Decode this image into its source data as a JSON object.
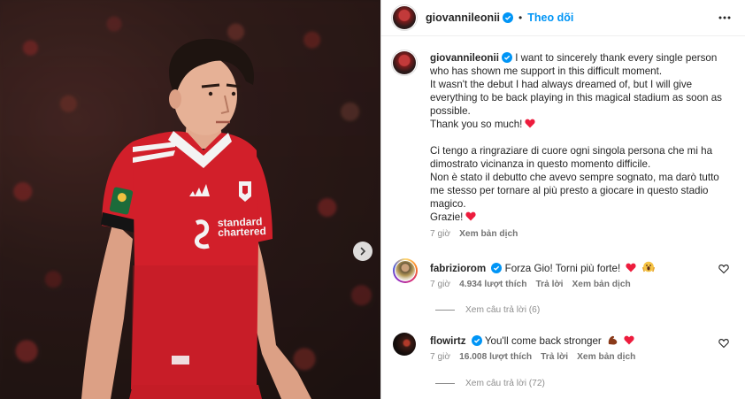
{
  "post": {
    "username": "giovannileonii",
    "follow_label": "Theo dõi",
    "caption": {
      "en": [
        "I want to sincerely thank every single person who has shown me support in this difficult moment.",
        "It wasn't the debut I had always dreamed of, but I will give everything to be back playing in this magical stadium as soon as possible.",
        "Thank you so much!"
      ],
      "it": [
        "Ci tengo a ringraziare di cuore ogni singola persona che mi ha dimostrato vicinanza in questo momento difficile.",
        "Non è stato il debutto che avevo sempre sognato, ma darò tutto me stesso per tornare al più presto a giocare in questo stadio magico.",
        "Grazie!"
      ]
    },
    "time": "7 giờ",
    "translate": "Xem bản dịch"
  },
  "comments": [
    {
      "username": "fabriziorom",
      "text": "Forza Gio! Torni più forte!",
      "time": "7 giờ",
      "likes": "4.934 lượt thích",
      "reply": "Trả lời",
      "translate": "Xem bản dịch",
      "view_replies": "Xem câu trả lời (6)"
    },
    {
      "username": "flowirtz",
      "text": "You'll come back stronger",
      "time": "7 giờ",
      "likes": "16.008 lượt thích",
      "reply": "Trả lời",
      "translate": "Xem bản dịch",
      "view_replies": "Xem câu trả lời (72)"
    }
  ],
  "jersey": {
    "sponsor_line1": "standard",
    "sponsor_line2": "chartered"
  },
  "colors": {
    "accent": "#0095f6",
    "verified": "#0095f6",
    "heart": "#ed1c3d",
    "muted": "#8e8e8e",
    "jersey_red": "#d21f2a"
  },
  "icons": {
    "more": "more-horizontal-icon",
    "next": "chevron-right-icon",
    "like": "heart-outline-icon",
    "verified": "verified-badge-icon"
  }
}
